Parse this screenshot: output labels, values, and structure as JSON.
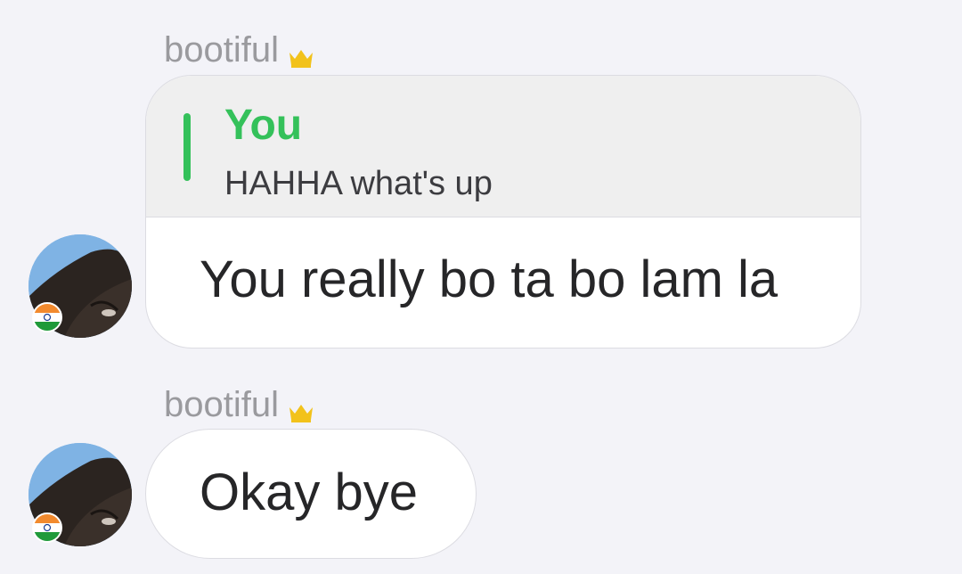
{
  "messages": [
    {
      "sender_name": "bootiful",
      "sender_badge": "crown-icon",
      "quote": {
        "author": "You",
        "text": "HAHHA what's up"
      },
      "text": "You really bo ta bo lam la"
    },
    {
      "sender_name": "bootiful",
      "sender_badge": "crown-icon",
      "text": "Okay bye"
    }
  ],
  "colors": {
    "background": "#f3f3f8",
    "bubble": "#ffffff",
    "quote_background": "#efefef",
    "quote_accent": "#34c15a",
    "sender_name": "#9a9a9e",
    "crown": "#f2c21b"
  }
}
